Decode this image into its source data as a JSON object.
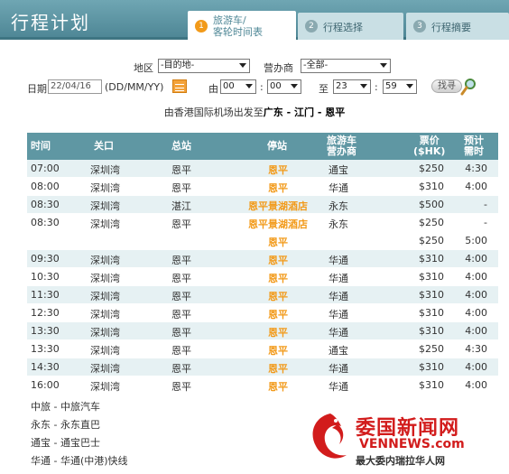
{
  "header": {
    "title": "行程计划",
    "tabs": [
      {
        "num": "1",
        "label": "旅游车/",
        "label2": "客轮时间表"
      },
      {
        "num": "2",
        "label": "行程选择"
      },
      {
        "num": "3",
        "label": "行程摘要"
      }
    ]
  },
  "form": {
    "region_label": "地区",
    "region_value": "-目的地-",
    "operator_label": "营办商",
    "operator_value": "-全部-",
    "date_label": "日期",
    "date_value": "22/04/16",
    "date_format": "(DD/MM/YY)",
    "from_label": "由",
    "from_hour": "00",
    "from_min": "00",
    "to_label": "至",
    "to_hour": "23",
    "to_min": "59",
    "time_sep": ":",
    "search_label": "找寻"
  },
  "route": {
    "prefix": "由香港国际机场出发至",
    "dest": "广东 - 江门 - 恩平"
  },
  "table": {
    "headers": {
      "time": "时间",
      "checkpoint": "关口",
      "terminal": "总站",
      "stop": "停站",
      "operator_1": "旅游车",
      "operator_2": "营办商",
      "price_1": "票价",
      "price_2": "($HK)",
      "duration_1": "预计",
      "duration_2": "需时"
    },
    "rows": [
      {
        "time": "07:00",
        "checkpoint": "深圳湾",
        "terminal": "恩平",
        "stop": "恩平",
        "operator": "通宝",
        "price": "$250",
        "duration": "4:30"
      },
      {
        "time": "08:00",
        "checkpoint": "深圳湾",
        "terminal": "恩平",
        "stop": "恩平",
        "operator": "华通",
        "price": "$310",
        "duration": "4:00"
      },
      {
        "time": "08:30",
        "checkpoint": "深圳湾",
        "terminal": "湛江",
        "stop": "恩平景湖酒店",
        "operator": "永东",
        "price": "$500",
        "duration": "-"
      },
      {
        "time": "08:30",
        "checkpoint": "深圳湾",
        "terminal": "恩平",
        "stop": "恩平景湖酒店",
        "stop2": "恩平",
        "operator": "永东",
        "price": "$250",
        "price2": "$250",
        "duration": "-",
        "duration2": "5:00"
      },
      {
        "time": "09:30",
        "checkpoint": "深圳湾",
        "terminal": "恩平",
        "stop": "恩平",
        "operator": "华通",
        "price": "$310",
        "duration": "4:00"
      },
      {
        "time": "10:30",
        "checkpoint": "深圳湾",
        "terminal": "恩平",
        "stop": "恩平",
        "operator": "华通",
        "price": "$310",
        "duration": "4:00"
      },
      {
        "time": "11:30",
        "checkpoint": "深圳湾",
        "terminal": "恩平",
        "stop": "恩平",
        "operator": "华通",
        "price": "$310",
        "duration": "4:00"
      },
      {
        "time": "12:30",
        "checkpoint": "深圳湾",
        "terminal": "恩平",
        "stop": "恩平",
        "operator": "华通",
        "price": "$310",
        "duration": "4:00"
      },
      {
        "time": "13:30",
        "checkpoint": "深圳湾",
        "terminal": "恩平",
        "stop": "恩平",
        "operator": "华通",
        "price": "$310",
        "duration": "4:00"
      },
      {
        "time": "13:30",
        "checkpoint": "深圳湾",
        "terminal": "恩平",
        "stop": "恩平",
        "operator": "通宝",
        "price": "$250",
        "duration": "4:30"
      },
      {
        "time": "14:30",
        "checkpoint": "深圳湾",
        "terminal": "恩平",
        "stop": "恩平",
        "operator": "华通",
        "price": "$310",
        "duration": "4:00"
      },
      {
        "time": "16:00",
        "checkpoint": "深圳湾",
        "terminal": "恩平",
        "stop": "恩平",
        "operator": "华通",
        "price": "$310",
        "duration": "4:00"
      }
    ]
  },
  "legend": [
    "中旅 - 中旅汽车",
    "永东 - 永东直巴",
    "通宝 - 通宝巴士",
    "华通 - 华通(中港)快线"
  ],
  "logo": {
    "line1": "委国新闻网",
    "line2": "VENNEWS.com",
    "line3": "最大委内瑞拉华人网"
  },
  "colors": {
    "header": "#5f97a3",
    "accent": "#f29a1a",
    "logo_red": "#d21c1c"
  }
}
